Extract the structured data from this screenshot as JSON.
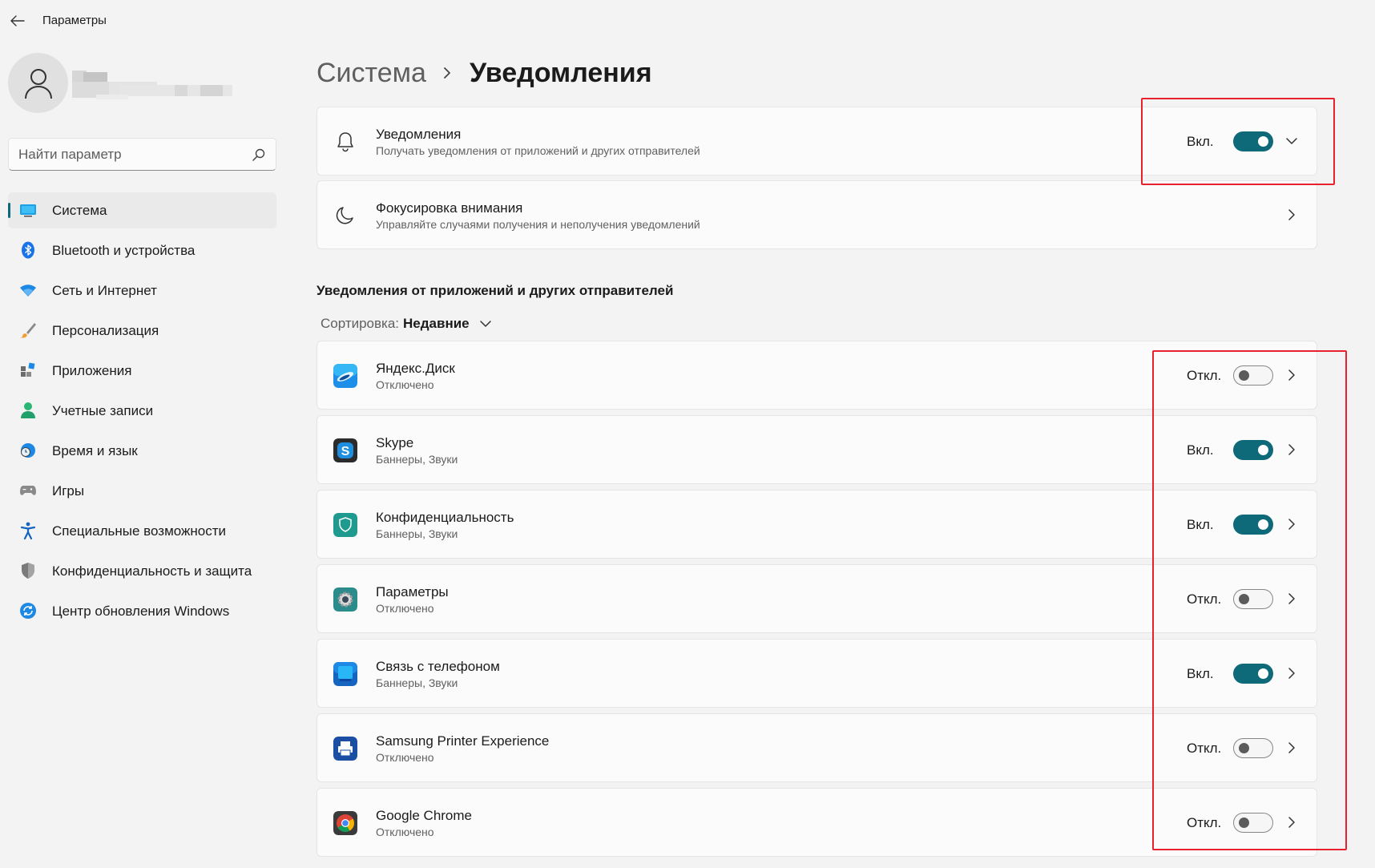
{
  "window": {
    "title": "Параметры"
  },
  "search": {
    "placeholder": "Найти параметр"
  },
  "sidebar": {
    "items": [
      {
        "label": "Система",
        "icon": "system-icon",
        "active": true
      },
      {
        "label": "Bluetooth и устройства",
        "icon": "bluetooth-icon"
      },
      {
        "label": "Сеть и Интернет",
        "icon": "wifi-icon"
      },
      {
        "label": "Персонализация",
        "icon": "brush-icon"
      },
      {
        "label": "Приложения",
        "icon": "apps-icon"
      },
      {
        "label": "Учетные записи",
        "icon": "accounts-icon"
      },
      {
        "label": "Время и язык",
        "icon": "globe-clock-icon"
      },
      {
        "label": "Игры",
        "icon": "gamepad-icon"
      },
      {
        "label": "Специальные возможности",
        "icon": "accessibility-icon"
      },
      {
        "label": "Конфиденциальность и защита",
        "icon": "shield-icon"
      },
      {
        "label": "Центр обновления Windows",
        "icon": "update-icon"
      }
    ]
  },
  "breadcrumb": {
    "parent": "Система",
    "current": "Уведомления"
  },
  "notifications": {
    "title": "Уведомления",
    "subtitle": "Получать уведомления от приложений и других отправителей",
    "state": "Вкл.",
    "on": true
  },
  "focus": {
    "title": "Фокусировка внимания",
    "subtitle": "Управляйте случаями получения и неполучения уведомлений"
  },
  "apps_section": {
    "title": "Уведомления от приложений и других отправителей",
    "sort_label": "Сортировка:",
    "sort_value": "Недавние"
  },
  "apps": [
    {
      "name": "Яндекс.Диск",
      "detail": "Отключено",
      "state": "Откл.",
      "on": false,
      "icon": "yandex-disk-icon"
    },
    {
      "name": "Skype",
      "detail": "Баннеры, Звуки",
      "state": "Вкл.",
      "on": true,
      "icon": "skype-icon"
    },
    {
      "name": "Конфиденциальность",
      "detail": "Баннеры, Звуки",
      "state": "Вкл.",
      "on": true,
      "icon": "privacy-shield-icon"
    },
    {
      "name": "Параметры",
      "detail": "Отключено",
      "state": "Откл.",
      "on": false,
      "icon": "settings-gear-icon"
    },
    {
      "name": "Связь с телефоном",
      "detail": "Баннеры, Звуки",
      "state": "Вкл.",
      "on": true,
      "icon": "phone-link-icon"
    },
    {
      "name": "Samsung Printer Experience",
      "detail": "Отключено",
      "state": "Откл.",
      "on": false,
      "icon": "printer-icon"
    },
    {
      "name": "Google Chrome",
      "detail": "Отключено",
      "state": "Откл.",
      "on": false,
      "icon": "chrome-icon"
    }
  ],
  "colors": {
    "accent": "#0e6978",
    "highlight": "#e8212f",
    "background": "#f3f3f3",
    "card": "#fbfbfb"
  }
}
